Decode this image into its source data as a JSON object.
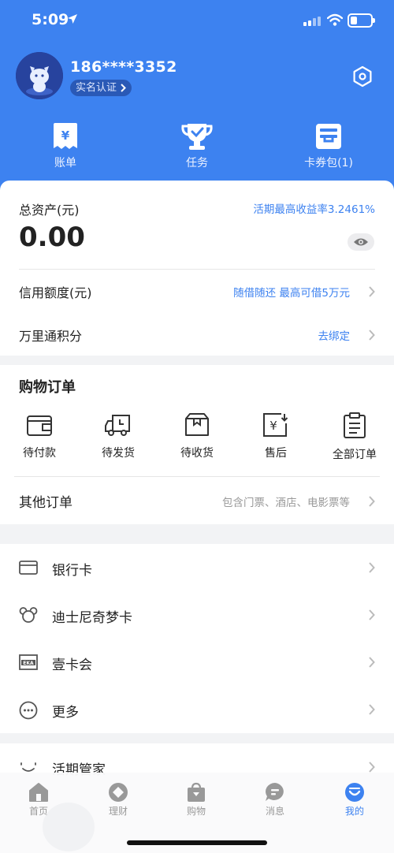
{
  "status": {
    "time": "5:09"
  },
  "profile": {
    "phone": "186****3352",
    "realname_label": "实名认证"
  },
  "quick_actions": [
    {
      "label": "账单",
      "icon": "bill-icon"
    },
    {
      "label": "任务",
      "icon": "trophy-icon"
    },
    {
      "label": "卡券包(1)",
      "icon": "coupon-wallet-icon"
    }
  ],
  "assets": {
    "title": "总资产(元)",
    "promo": "活期最高收益率3.2461%",
    "amount": "0.00",
    "credit_label": "信用额度(元)",
    "credit_promo": "随借随还 最高可借5万元",
    "points_label": "万里通积分",
    "points_action": "去绑定"
  },
  "orders": {
    "title": "购物订单",
    "items": [
      {
        "label": "待付款",
        "icon": "wallet-icon"
      },
      {
        "label": "待发货",
        "icon": "truck-icon"
      },
      {
        "label": "待收货",
        "icon": "package-icon"
      },
      {
        "label": "售后",
        "icon": "refund-icon"
      },
      {
        "label": "全部订单",
        "icon": "clipboard-icon"
      }
    ],
    "other_label": "其他订单",
    "other_hint": "包含门票、酒店、电影票等"
  },
  "menu": [
    {
      "label": "银行卡",
      "icon": "bank-card-icon"
    },
    {
      "label": "迪士尼奇梦卡",
      "icon": "mickey-icon"
    },
    {
      "label": "壹卡会",
      "icon": "eka-icon"
    },
    {
      "label": "更多",
      "icon": "more-icon"
    }
  ],
  "menu2": [
    {
      "label": "活期管家",
      "icon": "smile-icon"
    }
  ],
  "eka_icon_text": "EKA",
  "tabs": [
    {
      "label": "首页",
      "icon": "home-icon",
      "active": false
    },
    {
      "label": "理财",
      "icon": "finance-icon",
      "active": false
    },
    {
      "label": "购物",
      "icon": "shopping-bag-icon",
      "active": false
    },
    {
      "label": "消息",
      "icon": "message-icon",
      "active": false
    },
    {
      "label": "我的",
      "icon": "profile-icon",
      "active": true
    }
  ],
  "colors": {
    "brand_blue": "#3d82f0",
    "background": "#f2f3f5",
    "muted_text": "#999999"
  }
}
